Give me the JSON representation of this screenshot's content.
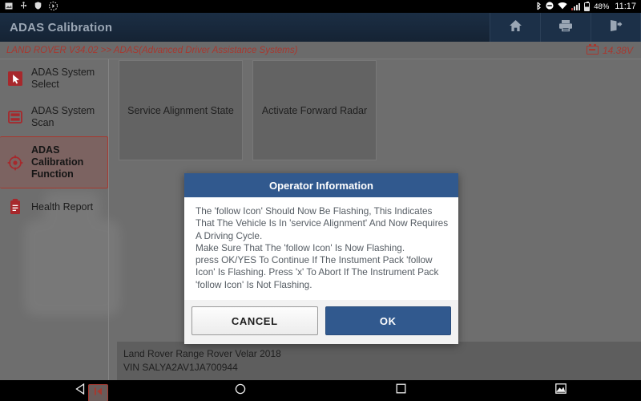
{
  "statusbar": {
    "icons_left": [
      "screenshot-icon",
      "usb-icon",
      "shield-icon",
      "bluetooth-settings-icon"
    ],
    "bluetooth": "bluetooth-icon",
    "dnd": "do-not-disturb-icon",
    "wifi": "wifi-icon",
    "signal": "cellular-signal-icon",
    "battery_percent": "48%",
    "time": "11:17"
  },
  "header": {
    "title": "ADAS Calibration",
    "actions": [
      {
        "name": "home-button",
        "icon": "home-icon"
      },
      {
        "name": "print-button",
        "icon": "printer-icon"
      },
      {
        "name": "exit-button",
        "icon": "exit-icon"
      }
    ]
  },
  "breadcrumb": {
    "text": "LAND ROVER V34.02 >> ADAS(Advanced Driver Assistance Systems)",
    "voltage": "14.38V",
    "voltage_icon": "battery-voltage-icon",
    "accent_color": "#a7382f"
  },
  "sidebar": {
    "items": [
      {
        "label": "ADAS System Select",
        "icon": "cursor-select-icon",
        "selected": false
      },
      {
        "label": "ADAS System Scan",
        "icon": "scan-icon",
        "selected": false
      },
      {
        "label": "ADAS Calibration Function",
        "icon": "target-crosshair-icon",
        "selected": true
      },
      {
        "label": "Health Report",
        "icon": "clipboard-report-icon",
        "selected": false
      }
    ],
    "collapse_icon": "collapse-left-icon"
  },
  "main": {
    "cards": [
      {
        "label": "Service Alignment State"
      },
      {
        "label": "Activate Forward Radar"
      }
    ]
  },
  "vehicle": {
    "model": "Land Rover Range Rover Velar 2018",
    "vin": "VIN SALYA2AV1JA700944"
  },
  "dialog": {
    "title": "Operator Information",
    "title_bg": "#31598e",
    "paragraphs": [
      "The 'follow Icon' Should Now Be Flashing, This Indicates That The Vehicle Is In 'service Alignment' And Now Requires A Driving Cycle.",
      "Make Sure That The 'follow Icon' Is Now Flashing.",
      "press OK/YES To Continue If The Instument Pack 'follow Icon' Is Flashing. Press 'x' To Abort If The Instrument Pack 'follow Icon' Is Not Flashing."
    ],
    "cancel_label": "CANCEL",
    "ok_label": "OK"
  },
  "navbar": {
    "buttons": [
      {
        "name": "nav-back-button",
        "icon": "back-triangle-icon"
      },
      {
        "name": "nav-home-button",
        "icon": "home-circle-icon"
      },
      {
        "name": "nav-recents-button",
        "icon": "recents-square-icon"
      },
      {
        "name": "nav-screenshot-button",
        "icon": "screenshot-icon"
      }
    ]
  }
}
